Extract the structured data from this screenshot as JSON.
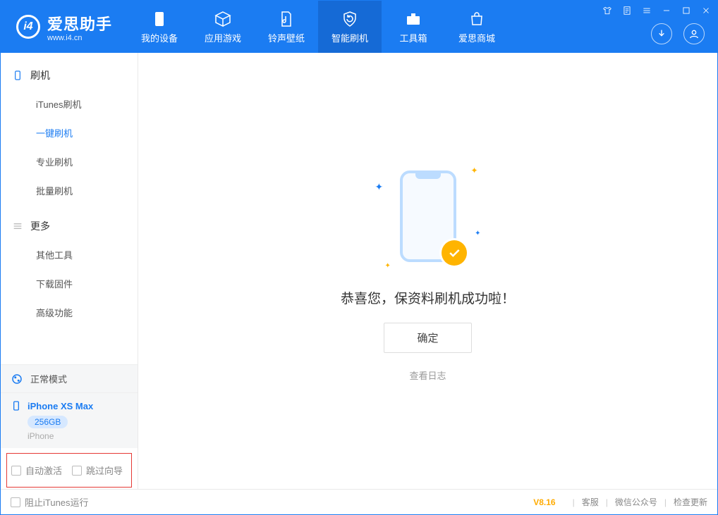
{
  "app": {
    "logo_cn": "爱思助手",
    "logo_en": "www.i4.cn"
  },
  "nav": {
    "device": "我的设备",
    "apps": "应用游戏",
    "ring": "铃声壁纸",
    "flash": "智能刷机",
    "tools": "工具箱",
    "store": "爱思商城"
  },
  "sidebar": {
    "section_flash": "刷机",
    "itunes": "iTunes刷机",
    "onekey": "一键刷机",
    "pro": "专业刷机",
    "batch": "批量刷机",
    "section_more": "更多",
    "other": "其他工具",
    "firmware": "下载固件",
    "advanced": "高级功能"
  },
  "status_mode": "正常模式",
  "device": {
    "name": "iPhone XS Max",
    "storage": "256GB",
    "type": "iPhone"
  },
  "options": {
    "auto_activate": "自动激活",
    "skip_wizard": "跳过向导"
  },
  "main": {
    "success_text": "恭喜您，保资料刷机成功啦！",
    "ok": "确定",
    "view_log": "查看日志"
  },
  "statusbar": {
    "block_itunes": "阻止iTunes运行",
    "version": "V8.16",
    "support": "客服",
    "wechat": "微信公众号",
    "check_update": "检查更新"
  }
}
